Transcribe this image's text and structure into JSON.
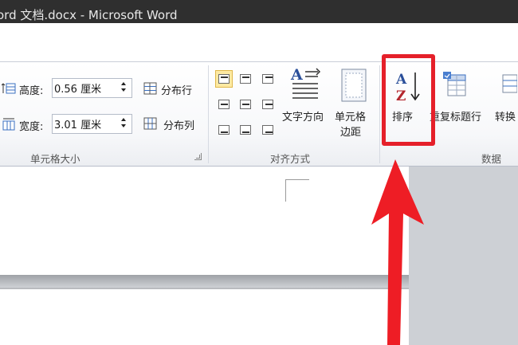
{
  "window": {
    "title": "ord 文档.docx - Microsoft Word"
  },
  "ribbon": {
    "cell_size": {
      "height_label": "高度:",
      "height_value": "0.56 厘米",
      "width_label": "宽度:",
      "width_value": "3.01 厘米",
      "distribute_rows": "分布行",
      "distribute_cols": "分布列",
      "group_label": "单元格大小"
    },
    "alignment": {
      "text_direction": "文字方向",
      "cell_margin_line1": "单元格",
      "cell_margin_line2": "边距",
      "group_label": "对齐方式"
    },
    "data": {
      "sort": "排序",
      "repeat_header_rows": "重复标题行",
      "convert": "转换",
      "group_label": "数据"
    }
  },
  "colors": {
    "highlight": "#e5202a",
    "active_align": "#fde9a2",
    "titlebar": "#2f2f2f"
  }
}
